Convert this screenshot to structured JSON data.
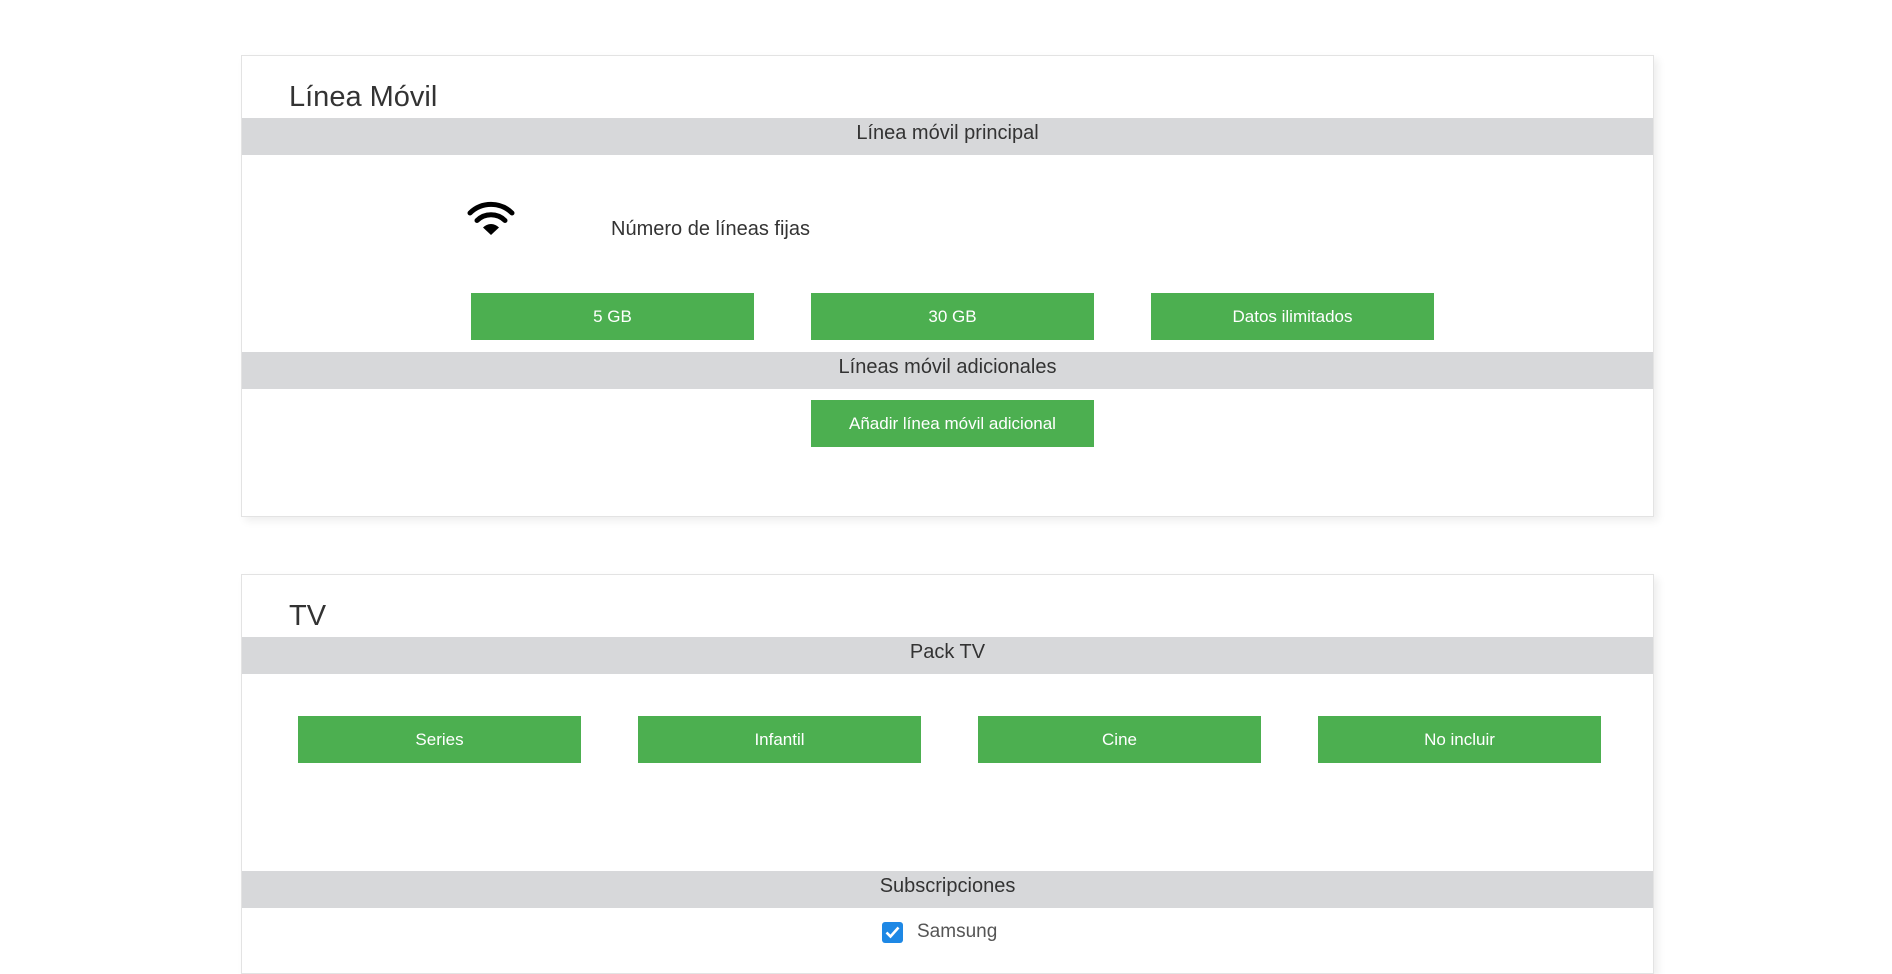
{
  "movil": {
    "title": "Línea Móvil",
    "principal_band": "Línea móvil principal",
    "lines_label": "Número de líneas fijas",
    "data_options": [
      "5 GB",
      "30 GB",
      "Datos ilimitados"
    ],
    "adicionales_band": "Líneas móvil adicionales",
    "add_button": "Añadir línea móvil adicional"
  },
  "tv": {
    "title": "TV",
    "pack_band": "Pack TV",
    "packs": [
      "Series",
      "Infantil",
      "Cine",
      "No incluir"
    ],
    "subs_band": "Subscripciones",
    "subscriptions": [
      {
        "label": "Samsung",
        "checked": true
      }
    ]
  },
  "colors": {
    "button_green": "#4caf50",
    "band_gray": "#d7d8da",
    "checkbox_blue": "#1e88e5"
  },
  "icons": {
    "signal": "wifi-icon",
    "check": "check-icon"
  }
}
